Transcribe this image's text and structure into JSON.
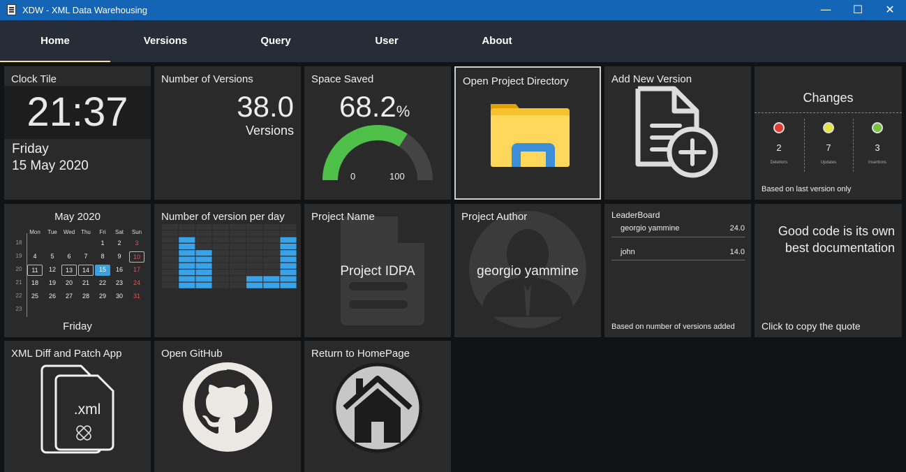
{
  "window": {
    "title": "XDW - XML Data Warehousing",
    "minimize": "—",
    "maximize": "☐",
    "close": "✕"
  },
  "nav": {
    "tabs": [
      "Home",
      "Versions",
      "Query",
      "User",
      "About"
    ]
  },
  "clock": {
    "title": "Clock Tile",
    "time": "21:37",
    "day": "Friday",
    "date": "15 May 2020"
  },
  "versions_count": {
    "title": "Number of Versions",
    "value": "38.0",
    "unit": "Versions"
  },
  "space": {
    "title": "Space Saved",
    "value": "68.2",
    "unit": "%",
    "min": "0",
    "max": "100",
    "percent": 68.2,
    "color": "#4ec04a"
  },
  "open_dir": {
    "title": "Open Project Directory"
  },
  "add_version": {
    "title": "Add New Version"
  },
  "changes": {
    "title": "Changes",
    "items": [
      {
        "count": "2",
        "label": "Deletions",
        "color": "#e53935"
      },
      {
        "count": "7",
        "label": "Updates",
        "color": "#e6e43a"
      },
      {
        "count": "3",
        "label": "Insertions",
        "color": "#7cc242"
      }
    ],
    "footer": "Based on last version only"
  },
  "calendar": {
    "month": "May 2020",
    "headers": [
      "Mon",
      "Tue",
      "Wed",
      "Thu",
      "Fri",
      "Sat",
      "Sun"
    ],
    "weeks": [
      {
        "wk": "18",
        "days": [
          "",
          "",
          "",
          "",
          "1",
          "2",
          "3"
        ]
      },
      {
        "wk": "19",
        "days": [
          "4",
          "5",
          "6",
          "7",
          "8",
          "9",
          "10"
        ]
      },
      {
        "wk": "20",
        "days": [
          "11",
          "12",
          "13",
          "14",
          "15",
          "16",
          "17"
        ]
      },
      {
        "wk": "21",
        "days": [
          "18",
          "19",
          "20",
          "21",
          "22",
          "23",
          "24"
        ]
      },
      {
        "wk": "22",
        "days": [
          "25",
          "26",
          "27",
          "28",
          "29",
          "30",
          "31"
        ]
      },
      {
        "wk": "23",
        "days": [
          "",
          "",
          "",
          "",
          "",
          "",
          ""
        ]
      }
    ],
    "footer": "Friday"
  },
  "per_day": {
    "title": "Number of version per day"
  },
  "chart_data": {
    "type": "bar",
    "title": "Number of version per day",
    "values": [
      0,
      4,
      3,
      0,
      0,
      1,
      1,
      4
    ],
    "ylim": [
      0,
      10
    ]
  },
  "project_name": {
    "title": "Project Name",
    "value": "Project IDPA"
  },
  "project_author": {
    "title": "Project Author",
    "value": "georgio yammine"
  },
  "leaderboard": {
    "title": "LeaderBoard",
    "rows": [
      {
        "name": "georgio yammine",
        "score": "24.0"
      },
      {
        "name": "john",
        "score": "14.0"
      }
    ],
    "footer": "Based on number of versions added"
  },
  "quote": {
    "text_line1": "Good code is its own",
    "text_line2": "best documentation",
    "footer": "Click to copy the quote"
  },
  "xml_app": {
    "title": "XML Diff and Patch App",
    "ext": ".xml"
  },
  "github": {
    "title": "Open GitHub"
  },
  "homepage": {
    "title": "Return to HomePage"
  }
}
